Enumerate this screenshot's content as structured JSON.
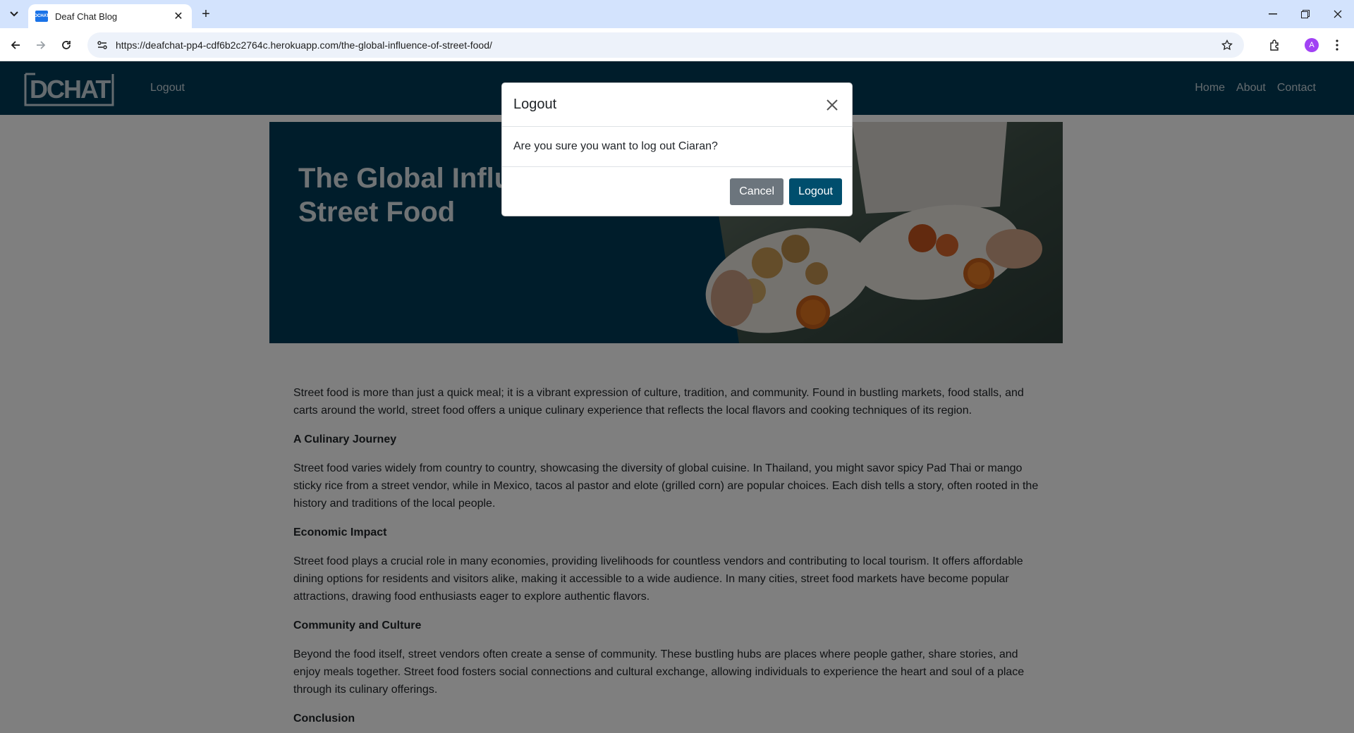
{
  "browser": {
    "tab_title": "Deaf Chat Blog",
    "favicon_text": "DCHAT",
    "url": "https://deafchat-pp4-cdf6b2c2764c.herokuapp.com/the-global-influence-of-street-food/",
    "profile_initial": "A"
  },
  "site": {
    "logo_text": "DCHAT",
    "nav_left": "Logout",
    "nav_right": [
      "Home",
      "About",
      "Contact"
    ],
    "brand_color": "#003b56"
  },
  "hero": {
    "title_line1": "The Global Influence of",
    "title_line2": "Street Food"
  },
  "article": {
    "intro": "Street food is more than just a quick meal; it is a vibrant expression of culture, tradition, and community. Found in bustling markets, food stalls, and carts around the world, street food offers a unique culinary experience that reflects the local flavors and cooking techniques of its region.",
    "sections": [
      {
        "heading": "A Culinary Journey",
        "body": "Street food varies widely from country to country, showcasing the diversity of global cuisine. In Thailand, you might savor spicy Pad Thai or mango sticky rice from a street vendor, while in Mexico, tacos al pastor and elote (grilled corn) are popular choices. Each dish tells a story, often rooted in the history and traditions of the local people."
      },
      {
        "heading": "Economic Impact",
        "body": "Street food plays a crucial role in many economies, providing livelihoods for countless vendors and contributing to local tourism. It offers affordable dining options for residents and visitors alike, making it accessible to a wide audience. In many cities, street food markets have become popular attractions, drawing food enthusiasts eager to explore authentic flavors."
      },
      {
        "heading": "Community and Culture",
        "body": "Beyond the food itself, street vendors often create a sense of community. These bustling hubs are places where people gather, share stories, and enjoy meals together. Street food fosters social connections and cultural exchange, allowing individuals to experience the heart and soul of a place through its culinary offerings."
      },
      {
        "heading": "Conclusion",
        "body": ""
      }
    ]
  },
  "modal": {
    "title": "Logout",
    "message": "Are you sure you want to log out Ciaran?",
    "cancel_label": "Cancel",
    "confirm_label": "Logout"
  }
}
